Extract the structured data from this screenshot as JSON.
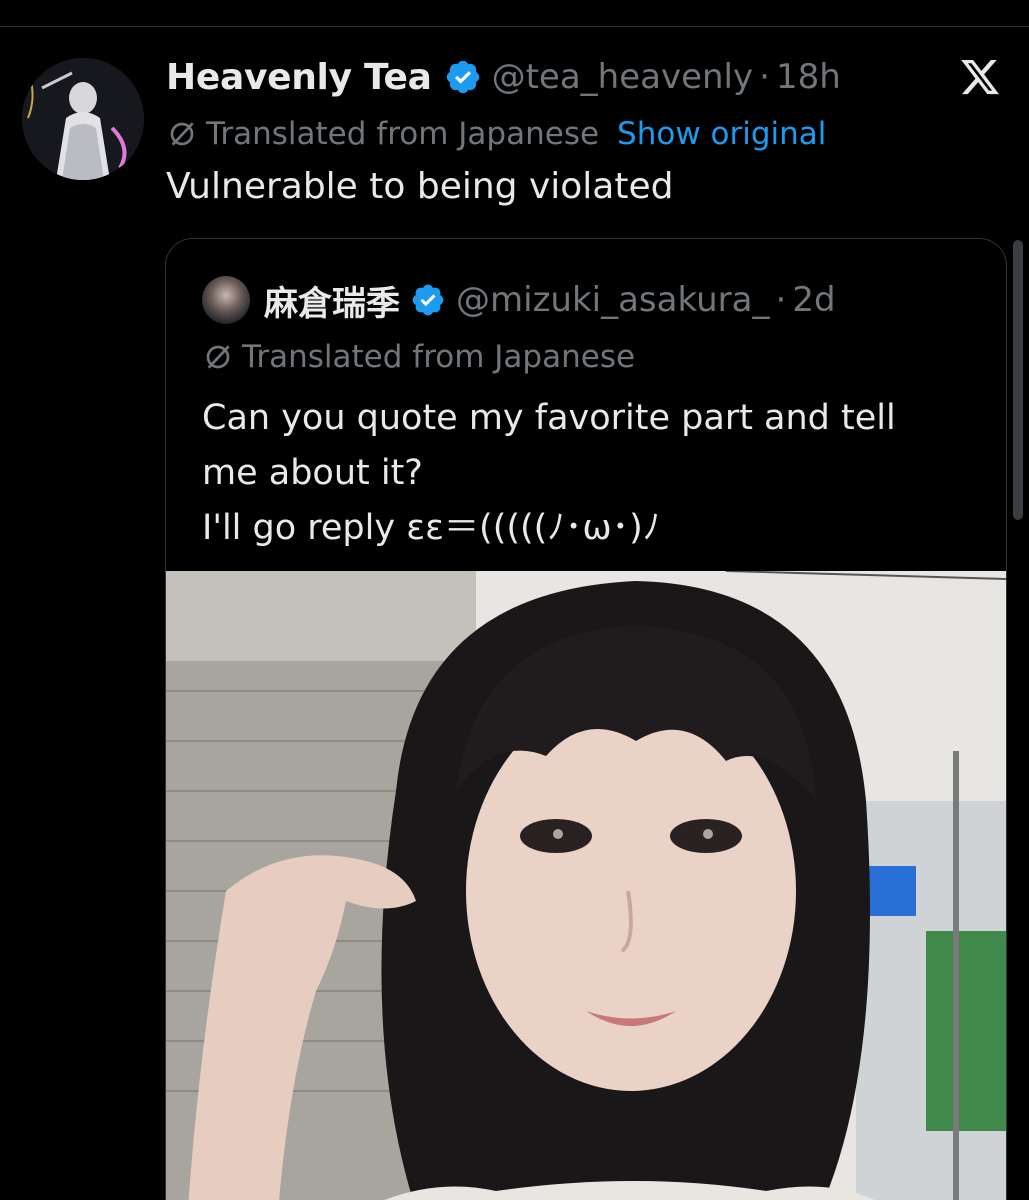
{
  "tweet": {
    "display_name": "Heavenly Tea",
    "handle": "@tea_heavenly",
    "separator": "·",
    "time": "18h",
    "translated_label": "Translated from Japanese",
    "show_original_label": "Show original",
    "text": "Vulnerable to being violated",
    "verified_icon": "verified-badge-icon",
    "platform_icon": "x-logo-icon"
  },
  "quoted_tweet": {
    "display_name": "麻倉瑞季",
    "handle": "@mizuki_asakura_",
    "separator": "·",
    "time": "2d",
    "translated_label": "Translated from Japanese",
    "text_lines": [
      "Can you quote my favorite part and tell",
      "me about it?",
      "I'll go reply εε＝(((((ﾉ･ω･)ﾉ"
    ],
    "media_icon": "photo-of-woman-with-dark-bob-hair"
  },
  "colors": {
    "background": "#000000",
    "primary_text": "#e7e9ea",
    "secondary_text": "#71767b",
    "link": "#1d9bf0",
    "verified": "#1d9bf0",
    "border": "#2f3336"
  }
}
